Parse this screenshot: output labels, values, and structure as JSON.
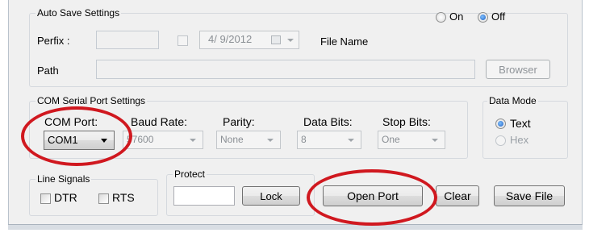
{
  "auto_save": {
    "title": "Auto Save Settings",
    "on_label": "On",
    "off_label": "Off",
    "selected": "Off",
    "prefix_label": "Perfix :",
    "prefix_value": "",
    "date_value": "4/ 9/2012",
    "file_name_label": "File Name",
    "path_label": "Path",
    "path_value": "",
    "browser_button": "Browser"
  },
  "com_settings": {
    "title": "COM Serial Port Settings",
    "com_port_label": "COM Port:",
    "com_port_value": "COM1",
    "baud_label": "Baud Rate:",
    "baud_value": "57600",
    "parity_label": "Parity:",
    "parity_value": "None",
    "data_bits_label": "Data Bits:",
    "data_bits_value": "8",
    "stop_bits_label": "Stop Bits:",
    "stop_bits_value": "One"
  },
  "data_mode": {
    "title": "Data Mode",
    "text_label": "Text",
    "hex_label": "Hex",
    "selected": "Text"
  },
  "line_signals": {
    "title": "Line Signals",
    "dtr_label": "DTR",
    "rts_label": "RTS"
  },
  "protect": {
    "title": "Protect",
    "value": "",
    "lock_button": "Lock"
  },
  "actions": {
    "open_port": "Open Port",
    "clear": "Clear",
    "save_file": "Save File"
  },
  "annotation_color": "#d0181f"
}
